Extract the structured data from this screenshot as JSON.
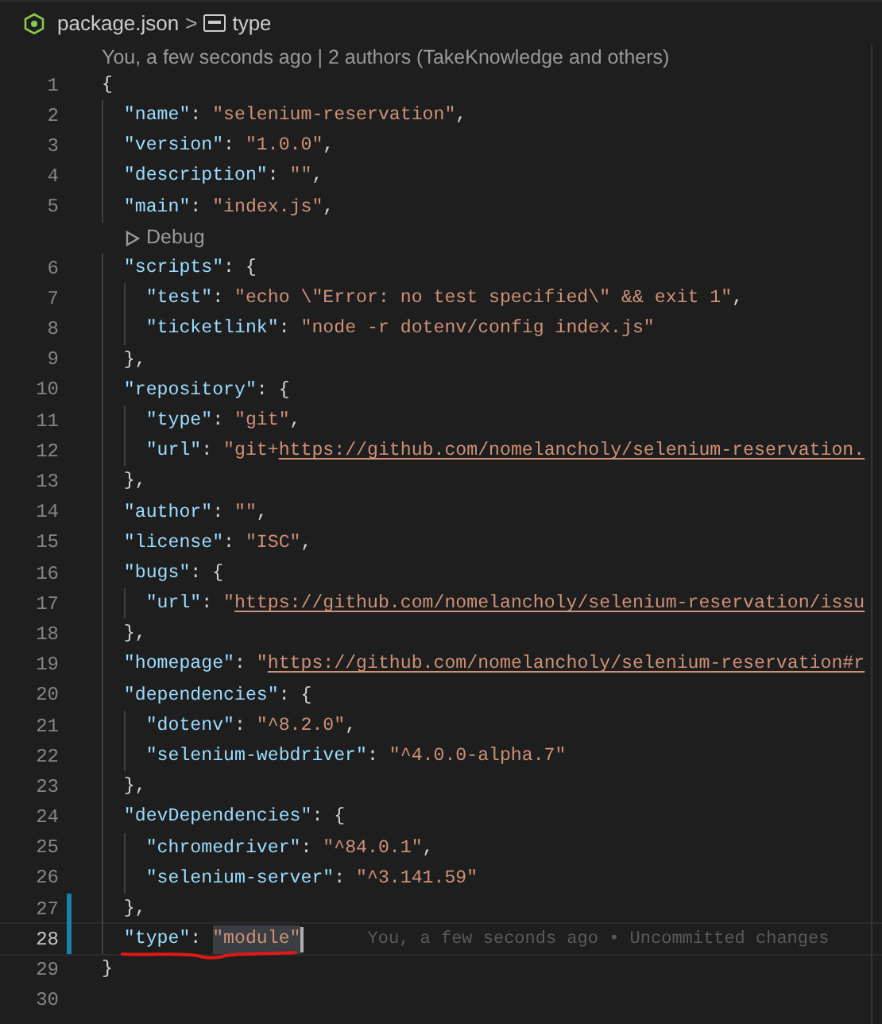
{
  "breadcrumb": {
    "file": "package.json",
    "separator": ">",
    "symbol": "type"
  },
  "blame_header": "You, a few seconds ago | 2 authors (TakeKnowledge and others)",
  "lines": [
    {
      "kind": "code",
      "number": "1",
      "modified": false,
      "tokens": [
        {
          "kind": "punct",
          "text": "{"
        }
      ]
    },
    {
      "kind": "code",
      "number": "2",
      "modified": false,
      "tokens": [
        {
          "kind": "key",
          "text": "  \"name\""
        },
        {
          "kind": "punct",
          "text": ": "
        },
        {
          "kind": "string",
          "text": "\"selenium-reservation\""
        },
        {
          "kind": "punct",
          "text": ","
        }
      ]
    },
    {
      "kind": "code",
      "number": "3",
      "modified": false,
      "tokens": [
        {
          "kind": "key",
          "text": "  \"version\""
        },
        {
          "kind": "punct",
          "text": ": "
        },
        {
          "kind": "string",
          "text": "\"1.0.0\""
        },
        {
          "kind": "punct",
          "text": ","
        }
      ]
    },
    {
      "kind": "code",
      "number": "4",
      "modified": false,
      "tokens": [
        {
          "kind": "key",
          "text": "  \"description\""
        },
        {
          "kind": "punct",
          "text": ": "
        },
        {
          "kind": "string",
          "text": "\"\""
        },
        {
          "kind": "punct",
          "text": ","
        }
      ]
    },
    {
      "kind": "code",
      "number": "5",
      "modified": false,
      "tokens": [
        {
          "kind": "key",
          "text": "  \"main\""
        },
        {
          "kind": "punct",
          "text": ": "
        },
        {
          "kind": "string",
          "text": "\"index.js\""
        },
        {
          "kind": "punct",
          "text": ","
        }
      ]
    },
    {
      "kind": "codelens",
      "text": "Debug"
    },
    {
      "kind": "code",
      "number": "6",
      "modified": false,
      "tokens": [
        {
          "kind": "key",
          "text": "  \"scripts\""
        },
        {
          "kind": "punct",
          "text": ": {"
        }
      ]
    },
    {
      "kind": "code",
      "number": "7",
      "modified": false,
      "tokens": [
        {
          "kind": "key",
          "text": "    \"test\""
        },
        {
          "kind": "punct",
          "text": ": "
        },
        {
          "kind": "string",
          "text": "\"echo \\\"Error: no test specified\\\" && exit 1\""
        },
        {
          "kind": "punct",
          "text": ","
        }
      ]
    },
    {
      "kind": "code",
      "number": "8",
      "modified": false,
      "tokens": [
        {
          "kind": "key",
          "text": "    \"ticketlink\""
        },
        {
          "kind": "punct",
          "text": ": "
        },
        {
          "kind": "string",
          "text": "\"node -r dotenv/config index.js\""
        }
      ]
    },
    {
      "kind": "code",
      "number": "9",
      "modified": false,
      "tokens": [
        {
          "kind": "punct",
          "text": "  },"
        }
      ]
    },
    {
      "kind": "code",
      "number": "10",
      "modified": false,
      "tokens": [
        {
          "kind": "key",
          "text": "  \"repository\""
        },
        {
          "kind": "punct",
          "text": ": {"
        }
      ]
    },
    {
      "kind": "code",
      "number": "11",
      "modified": false,
      "tokens": [
        {
          "kind": "key",
          "text": "    \"type\""
        },
        {
          "kind": "punct",
          "text": ": "
        },
        {
          "kind": "string",
          "text": "\"git\""
        },
        {
          "kind": "punct",
          "text": ","
        }
      ]
    },
    {
      "kind": "code",
      "number": "12",
      "modified": false,
      "tokens": [
        {
          "kind": "key",
          "text": "    \"url\""
        },
        {
          "kind": "punct",
          "text": ": "
        },
        {
          "kind": "string",
          "text": "\"git+"
        },
        {
          "kind": "link",
          "text": "https://github.com/nomelancholy/selenium-reservation."
        }
      ]
    },
    {
      "kind": "code",
      "number": "13",
      "modified": false,
      "tokens": [
        {
          "kind": "punct",
          "text": "  },"
        }
      ]
    },
    {
      "kind": "code",
      "number": "14",
      "modified": false,
      "tokens": [
        {
          "kind": "key",
          "text": "  \"author\""
        },
        {
          "kind": "punct",
          "text": ": "
        },
        {
          "kind": "string",
          "text": "\"\""
        },
        {
          "kind": "punct",
          "text": ","
        }
      ]
    },
    {
      "kind": "code",
      "number": "15",
      "modified": false,
      "tokens": [
        {
          "kind": "key",
          "text": "  \"license\""
        },
        {
          "kind": "punct",
          "text": ": "
        },
        {
          "kind": "string",
          "text": "\"ISC\""
        },
        {
          "kind": "punct",
          "text": ","
        }
      ]
    },
    {
      "kind": "code",
      "number": "16",
      "modified": false,
      "tokens": [
        {
          "kind": "key",
          "text": "  \"bugs\""
        },
        {
          "kind": "punct",
          "text": ": {"
        }
      ]
    },
    {
      "kind": "code",
      "number": "17",
      "modified": false,
      "tokens": [
        {
          "kind": "key",
          "text": "    \"url\""
        },
        {
          "kind": "punct",
          "text": ": "
        },
        {
          "kind": "string",
          "text": "\""
        },
        {
          "kind": "link",
          "text": "https://github.com/nomelancholy/selenium-reservation/issu"
        }
      ]
    },
    {
      "kind": "code",
      "number": "18",
      "modified": false,
      "tokens": [
        {
          "kind": "punct",
          "text": "  },"
        }
      ]
    },
    {
      "kind": "code",
      "number": "19",
      "modified": false,
      "tokens": [
        {
          "kind": "key",
          "text": "  \"homepage\""
        },
        {
          "kind": "punct",
          "text": ": "
        },
        {
          "kind": "string",
          "text": "\""
        },
        {
          "kind": "link",
          "text": "https://github.com/nomelancholy/selenium-reservation#r"
        }
      ]
    },
    {
      "kind": "code",
      "number": "20",
      "modified": false,
      "tokens": [
        {
          "kind": "key",
          "text": "  \"dependencies\""
        },
        {
          "kind": "punct",
          "text": ": {"
        }
      ]
    },
    {
      "kind": "code",
      "number": "21",
      "modified": false,
      "tokens": [
        {
          "kind": "key",
          "text": "    \"dotenv\""
        },
        {
          "kind": "punct",
          "text": ": "
        },
        {
          "kind": "string",
          "text": "\"^8.2.0\""
        },
        {
          "kind": "punct",
          "text": ","
        }
      ]
    },
    {
      "kind": "code",
      "number": "22",
      "modified": false,
      "tokens": [
        {
          "kind": "key",
          "text": "    \"selenium-webdriver\""
        },
        {
          "kind": "punct",
          "text": ": "
        },
        {
          "kind": "string",
          "text": "\"^4.0.0-alpha.7\""
        }
      ]
    },
    {
      "kind": "code",
      "number": "23",
      "modified": false,
      "tokens": [
        {
          "kind": "punct",
          "text": "  },"
        }
      ]
    },
    {
      "kind": "code",
      "number": "24",
      "modified": false,
      "tokens": [
        {
          "kind": "key",
          "text": "  \"devDependencies\""
        },
        {
          "kind": "punct",
          "text": ": {"
        }
      ]
    },
    {
      "kind": "code",
      "number": "25",
      "modified": false,
      "tokens": [
        {
          "kind": "key",
          "text": "    \"chromedriver\""
        },
        {
          "kind": "punct",
          "text": ": "
        },
        {
          "kind": "string",
          "text": "\"^84.0.1\""
        },
        {
          "kind": "punct",
          "text": ","
        }
      ]
    },
    {
      "kind": "code",
      "number": "26",
      "modified": false,
      "tokens": [
        {
          "kind": "key",
          "text": "    \"selenium-server\""
        },
        {
          "kind": "punct",
          "text": ": "
        },
        {
          "kind": "string",
          "text": "\"^3.141.59\""
        }
      ]
    },
    {
      "kind": "code",
      "number": "27",
      "modified": true,
      "tokens": [
        {
          "kind": "punct",
          "text": "  },"
        }
      ]
    },
    {
      "kind": "code",
      "number": "28",
      "modified": true,
      "current": true,
      "inline_blame": "You, a few seconds ago • Uncommitted changes",
      "tokens": [
        {
          "kind": "key",
          "text": "  \"type\""
        },
        {
          "kind": "punct",
          "text": ": "
        },
        {
          "kind": "selection",
          "text": "\"module\""
        }
      ]
    },
    {
      "kind": "code",
      "number": "29",
      "modified": false,
      "tokens": [
        {
          "kind": "punct",
          "text": "}"
        }
      ]
    },
    {
      "kind": "code",
      "number": "30",
      "modified": false
    }
  ]
}
